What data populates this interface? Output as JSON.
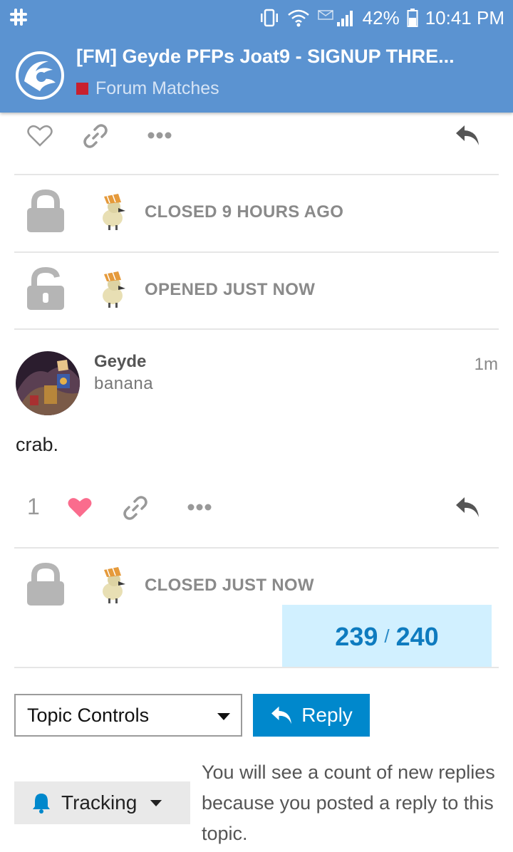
{
  "status_bar": {
    "battery": "42%",
    "time": "10:41 PM"
  },
  "header": {
    "title": "[FM] Geyde PFPs Joat9 - SIGNUP THRE...",
    "category": "Forum Matches",
    "category_color": "#c8202f",
    "accent": "#5b93d1"
  },
  "events": [
    {
      "icon": "lock-icon",
      "text": "CLOSED 9 HOURS AGO"
    },
    {
      "icon": "unlock-icon",
      "text": "OPENED JUST NOW"
    },
    {
      "icon": "lock-icon",
      "text": "CLOSED JUST NOW"
    }
  ],
  "post": {
    "username": "Geyde",
    "user_title": "banana",
    "time": "1m",
    "body": "crab.",
    "like_count": "1",
    "like_color": "#fa6c8d"
  },
  "timeline": {
    "current": "239",
    "separator": "/",
    "total": "240"
  },
  "footer": {
    "topic_controls": "Topic Controls",
    "reply": "Reply",
    "tracking": "Tracking",
    "tracking_description": "You will see a count of new replies because you posted a reply to this topic."
  },
  "icons": [
    "slack-icon",
    "vibrate-icon",
    "wifi-icon",
    "signal-icon",
    "battery-icon",
    "heart-icon",
    "link-icon",
    "more-icon",
    "reply-icon",
    "lock-icon",
    "unlock-icon",
    "bell-icon",
    "caret-down-icon"
  ]
}
